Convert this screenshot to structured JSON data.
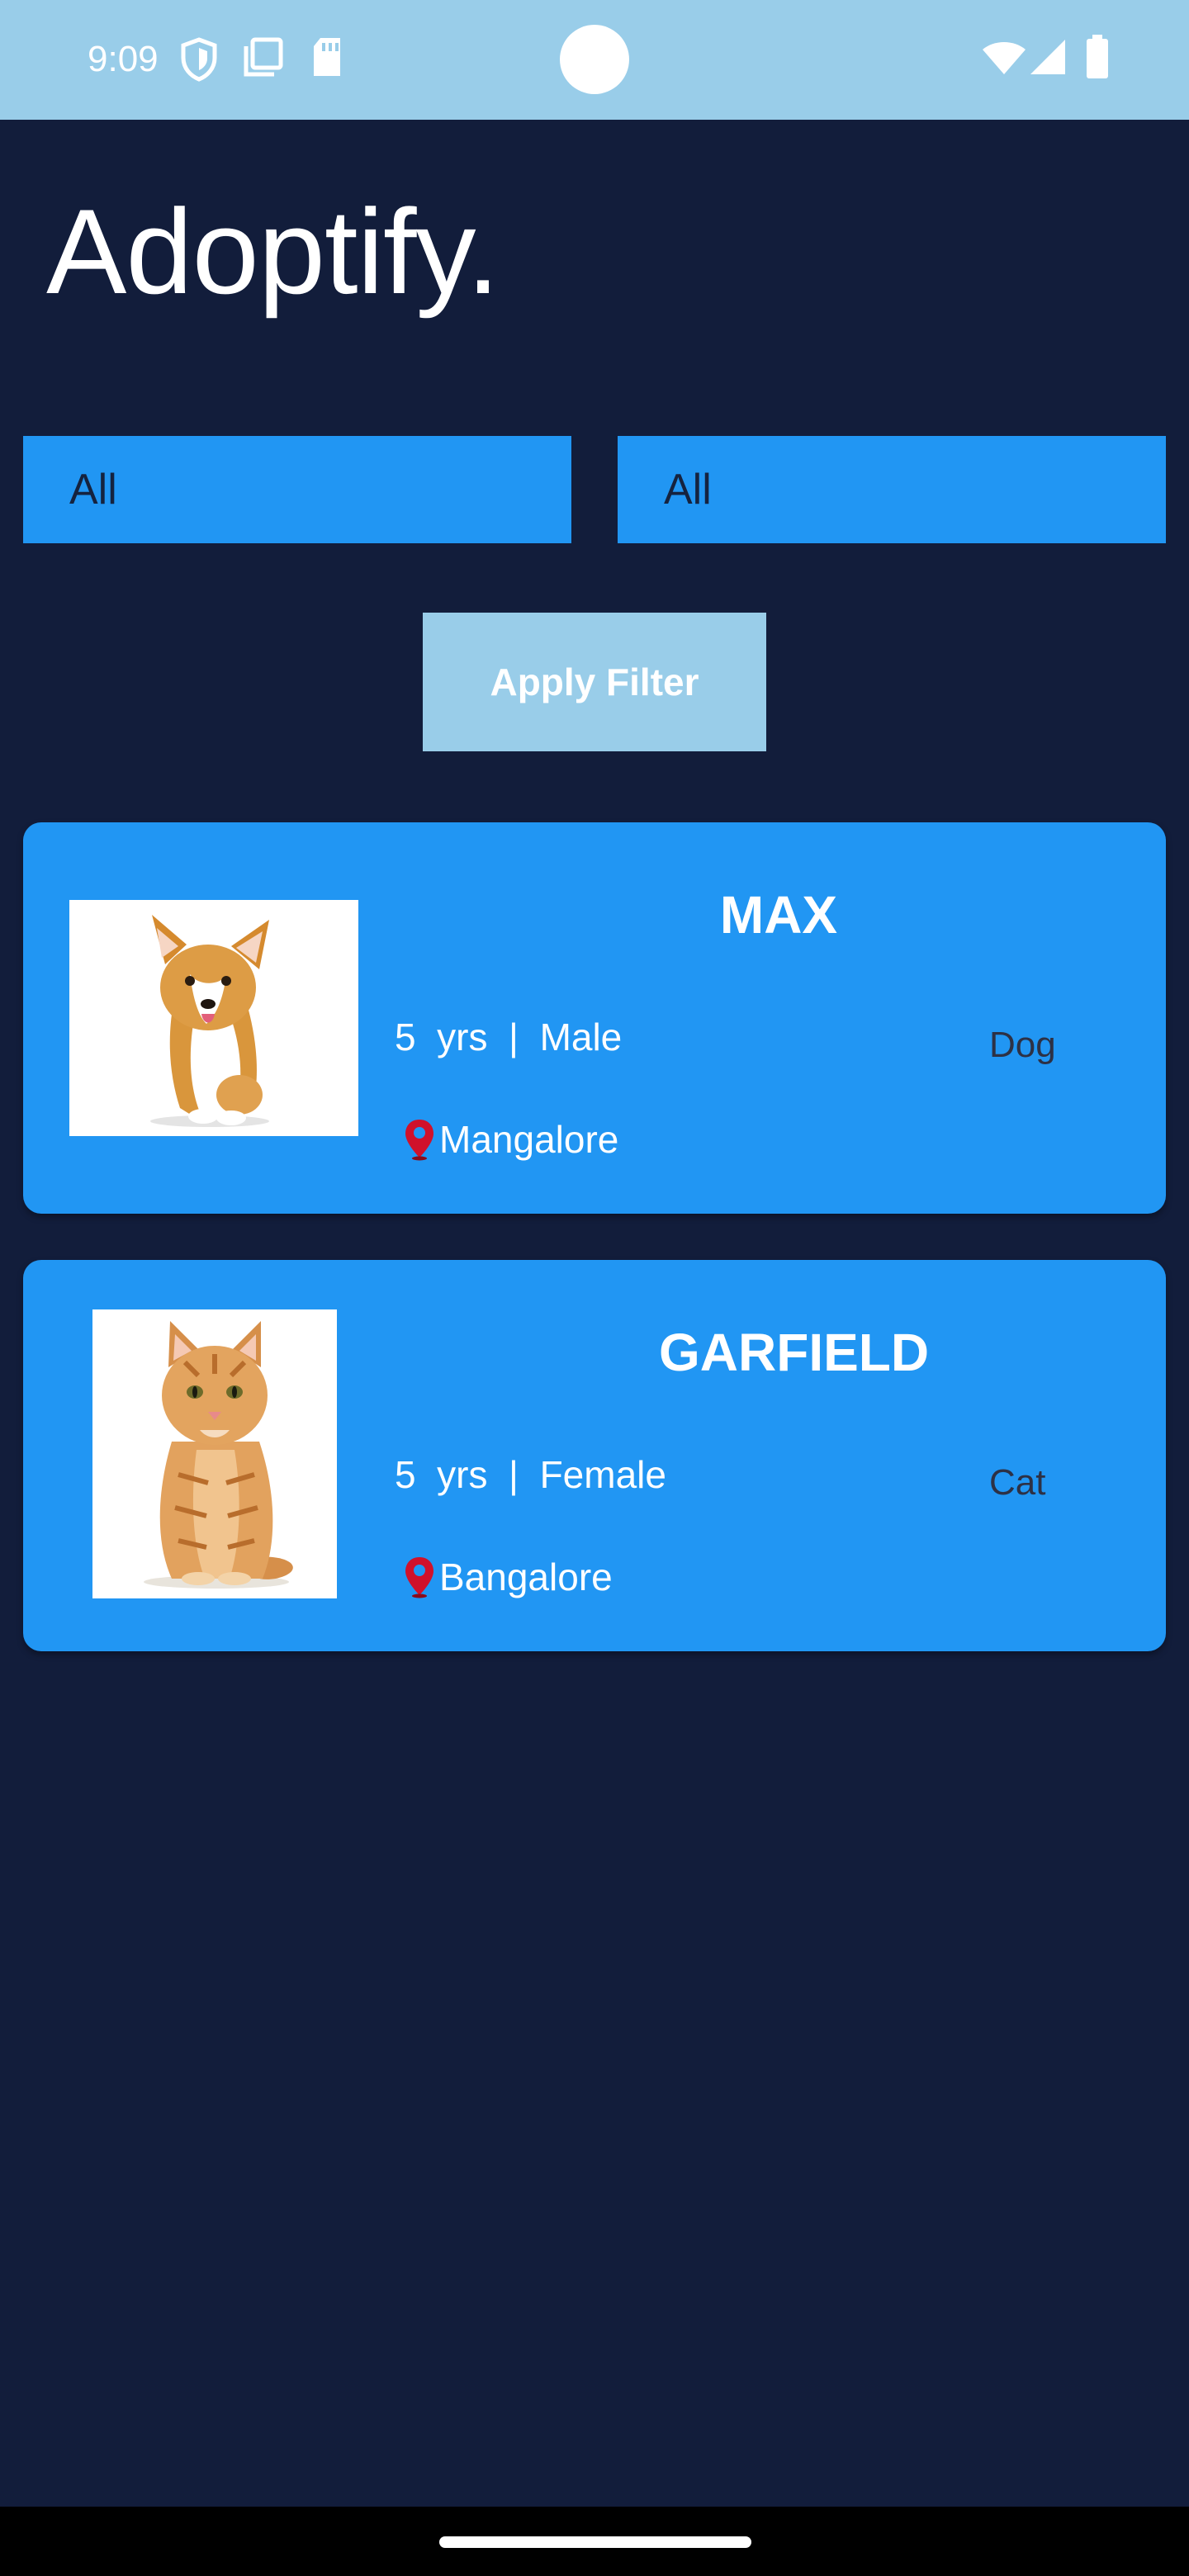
{
  "status_bar": {
    "time": "9:09",
    "icons_left": [
      "shield-icon",
      "copy-icon",
      "sd-card-icon"
    ],
    "icons_right": [
      "wifi-icon",
      "signal-icon",
      "battery-icon"
    ]
  },
  "app": {
    "title": "Adoptify."
  },
  "filters": {
    "type_value": "All",
    "location_value": "All",
    "apply_label": "Apply Filter"
  },
  "pets": [
    {
      "name": "MAX",
      "age": "5",
      "age_unit": "yrs",
      "gender": "Male",
      "type": "Dog",
      "location": "Mangalore",
      "photo_icon": "corgi-puppy-photo"
    },
    {
      "name": "GARFIELD",
      "age": "5",
      "age_unit": "yrs",
      "gender": "Female",
      "type": "Cat",
      "location": "Bangalore",
      "photo_icon": "ginger-kitten-photo"
    }
  ],
  "colors": {
    "background": "#121D3B",
    "status_bar": "#99CDE9",
    "accent": "#2196F3",
    "button": "#99CDE9",
    "pin": "#D0112B"
  }
}
